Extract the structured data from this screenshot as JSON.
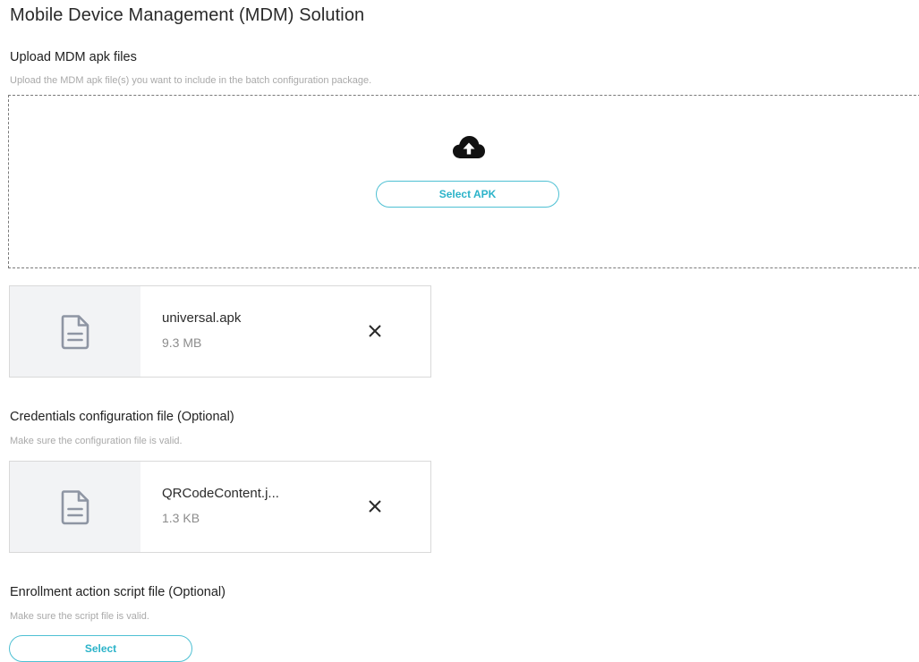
{
  "page": {
    "title": "Mobile Device Management (MDM) Solution"
  },
  "apk_section": {
    "title": "Upload MDM apk files",
    "hint": "Upload the MDM apk file(s) you want to include in the batch configuration package.",
    "upload_icon": "cloud-upload-icon",
    "select_label": "Select APK",
    "file": {
      "icon": "document-icon",
      "name": "universal.apk",
      "size": "9.3 MB",
      "remove_icon": "close-icon"
    }
  },
  "credentials_section": {
    "title": "Credentials configuration file (Optional)",
    "hint": "Make sure the configuration file is valid.",
    "file": {
      "icon": "document-icon",
      "name": "QRCodeContent.j...",
      "size": "1.3 KB",
      "remove_icon": "close-icon"
    }
  },
  "script_section": {
    "title": "Enrollment action script file (Optional)",
    "hint": "Make sure the script file is valid.",
    "select_label": "Select"
  },
  "colors": {
    "accent": "#2bb3c9",
    "accent_border": "#4ec0d3",
    "thumb_background": "#f2f3f5",
    "hint_text": "#a9a9a9"
  }
}
